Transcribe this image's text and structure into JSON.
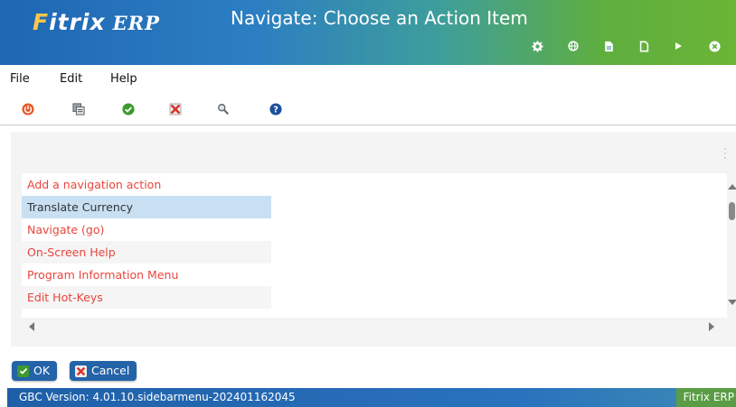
{
  "window": {
    "logo_prefix": "F",
    "logo_rest": "itrix",
    "logo_erp": "ERP",
    "title": "Navigate: Choose an Action Item"
  },
  "titlebar_icons": [
    "gear-icon",
    "globe-icon",
    "document-icon",
    "new-page-icon",
    "play-icon",
    "close-icon"
  ],
  "menu": {
    "items": [
      "File",
      "Edit",
      "Help"
    ]
  },
  "toolbar": {
    "buttons": [
      "power-icon",
      "copy-icon",
      "accept-icon",
      "cancel-icon",
      "search-icon",
      "help-icon"
    ]
  },
  "list": {
    "items": [
      {
        "label": "Add a navigation action",
        "selected": false
      },
      {
        "label": "Translate Currency",
        "selected": true
      },
      {
        "label": "Navigate (go)",
        "selected": false
      },
      {
        "label": "On-Screen Help",
        "selected": false
      },
      {
        "label": "Program Information Menu",
        "selected": false
      },
      {
        "label": "Edit Hot-Keys",
        "selected": false
      }
    ]
  },
  "buttons": {
    "ok_label": "OK",
    "cancel_label": "Cancel"
  },
  "status": {
    "version": "GBC Version: 4.01.10.sidebarmenu-202401162045",
    "app": "Fitrix ERP"
  },
  "colors": {
    "list_text": "#e8453c",
    "selected_bg": "#c9e0f3",
    "button_bg": "#2463a8",
    "status_bg": "#1f5fa8",
    "logo_accent": "#ffc74a"
  }
}
